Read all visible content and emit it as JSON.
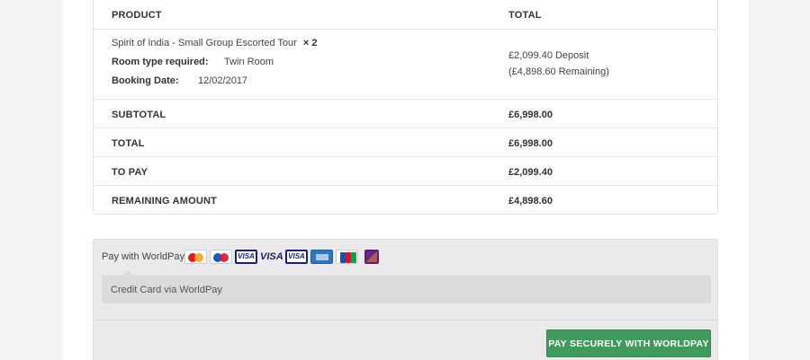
{
  "order": {
    "headers": {
      "product": "PRODUCT",
      "total": "TOTAL"
    },
    "item": {
      "name": "Spirit of India - Small Group Escorted Tour",
      "quantity": "× 2",
      "room_label": "Room type required:",
      "room_value": "Twin Room",
      "date_label": "Booking Date:",
      "date_value": "12/02/2017",
      "deposit": "£2,099.40 Deposit",
      "remaining": "(£4,898.60 Remaining)"
    },
    "totals": [
      {
        "label": "SUBTOTAL",
        "value": "£6,998.00"
      },
      {
        "label": "TOTAL",
        "value": "£6,998.00"
      },
      {
        "label": "TO PAY",
        "value": "£2,099.40"
      },
      {
        "label": "REMAINING AMOUNT",
        "value": "£4,898.60"
      }
    ]
  },
  "payment": {
    "method_label": "Pay with WorldPay",
    "cards": [
      "mastercard-icon",
      "maestro-icon",
      "visa-icon",
      "visa-electron-icon",
      "visa-debit-icon",
      "amex-icon",
      "jcb-icon",
      "worldpay-icon"
    ],
    "card_text": {
      "visa": "VISA"
    },
    "description": "Credit Card via WorldPay",
    "button_label": "PAY SECURELY WITH WORLDPAY",
    "button_color": "#3f9a5b"
  }
}
